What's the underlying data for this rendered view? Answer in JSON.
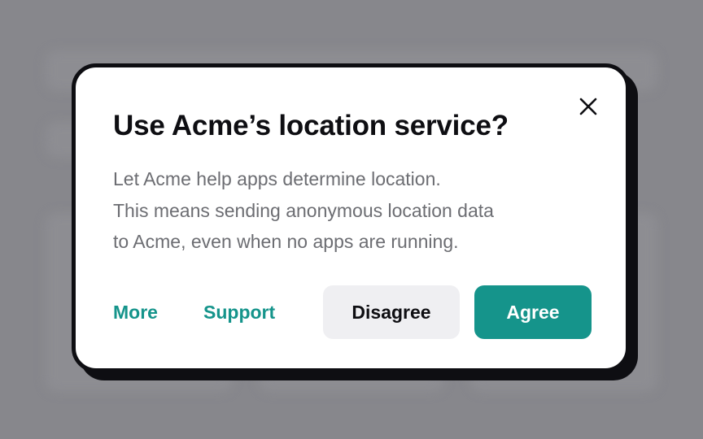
{
  "dialog": {
    "title": "Use Acme’s location service?",
    "body_lines": [
      "Let Acme help apps determine location.",
      "This means sending anonymous location data",
      "to Acme, even when no apps are running."
    ],
    "close_icon": "close-icon",
    "buttons": {
      "more": "More",
      "support": "Support",
      "disagree": "Disagree",
      "agree": "Agree"
    }
  },
  "colors": {
    "accent": "#15948b",
    "overlay": "#87878c",
    "dialog_background": "#ffffff",
    "dialog_border": "#0e0e12",
    "secondary_button": "#efeff2",
    "body_text": "#6c6d72"
  }
}
